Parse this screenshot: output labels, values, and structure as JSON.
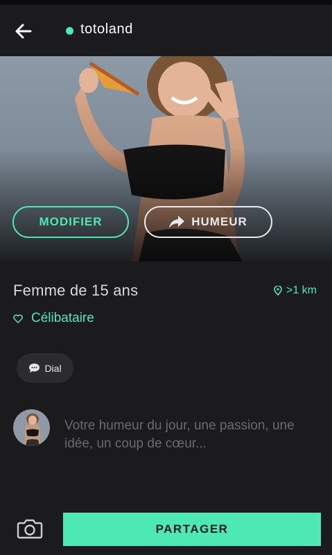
{
  "header": {
    "username": "totoland",
    "online": true
  },
  "profile": {
    "modify_label": "MODIFIER",
    "mood_label": "HUMEUR",
    "title": "Femme de 15 ans",
    "distance": ">1 km",
    "relationship_status": "Célibataire"
  },
  "chip": {
    "label": "Dial"
  },
  "composer": {
    "placeholder": "Votre humeur du jour, une passion, une idée, un coup de cœur..."
  },
  "footer": {
    "share_label": "PARTAGER"
  },
  "colors": {
    "accent": "#4ee8b4",
    "background": "#1b1a1d"
  },
  "icons": [
    "back-arrow-icon",
    "share-arrow-icon",
    "location-pin-icon",
    "heart-icon",
    "chat-bubble-icon",
    "camera-icon"
  ]
}
